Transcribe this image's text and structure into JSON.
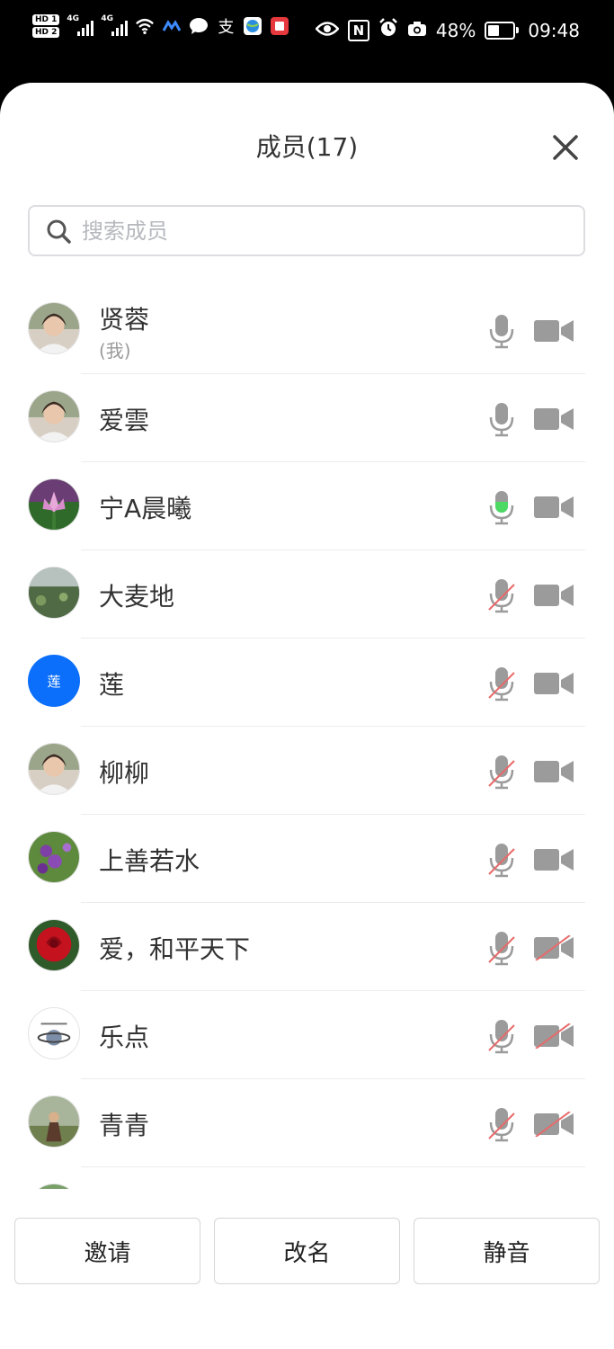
{
  "status_bar": {
    "hd1": "HD 1",
    "hd2": "HD 2",
    "net1": "4G",
    "net2": "4G",
    "alipay": "支",
    "nfc": "N",
    "battery_percent": "48%",
    "battery_level": 0.48,
    "time": "09:48",
    "icons": [
      "wifi-icon",
      "app-icon",
      "chat-icon",
      "alipay-icon",
      "browser-icon",
      "notes-icon",
      "eye-icon",
      "nfc-icon",
      "alarm-icon",
      "camera-icon"
    ]
  },
  "header": {
    "title": "成员(17)",
    "close_icon": "close-icon"
  },
  "search": {
    "placeholder": "搜索成员",
    "value": ""
  },
  "colors": {
    "accent_green": "#4cd964",
    "muted_red": "#e86a6a",
    "icon_gray": "#9b9b9b",
    "avatar_blue": "#0b6ffb"
  },
  "members": [
    {
      "name": "贤蓉",
      "sub": "(我)",
      "mic": "on",
      "cam": "on",
      "avatar": "photo-portrait-woman"
    },
    {
      "name": "爱雲",
      "mic": "on",
      "cam": "on",
      "avatar": "photo-portrait-woman"
    },
    {
      "name": "宁A晨曦",
      "mic": "speaking",
      "cam": "on",
      "avatar": "photo-lotus-flower"
    },
    {
      "name": "大麦地",
      "mic": "muted",
      "cam": "on",
      "avatar": "photo-landscape"
    },
    {
      "name": "莲",
      "mic": "muted",
      "cam": "on",
      "avatar": "letter",
      "avatar_letter": "莲"
    },
    {
      "name": "柳柳",
      "mic": "muted",
      "cam": "on",
      "avatar": "photo-portrait-woman"
    },
    {
      "name": "上善若水",
      "mic": "muted",
      "cam": "on",
      "avatar": "photo-purple-flowers"
    },
    {
      "name": "爱，和平天下",
      "mic": "muted",
      "cam": "off",
      "avatar": "photo-red-rose"
    },
    {
      "name": "乐点",
      "mic": "muted",
      "cam": "off",
      "avatar": "logo-planet"
    },
    {
      "name": "青青",
      "mic": "muted",
      "cam": "off",
      "avatar": "photo-person-outdoors"
    },
    {
      "name": "",
      "mic": "",
      "cam": "",
      "avatar": "photo-partial"
    }
  ],
  "actions": {
    "invite": "邀请",
    "rename": "改名",
    "mute": "静音"
  }
}
